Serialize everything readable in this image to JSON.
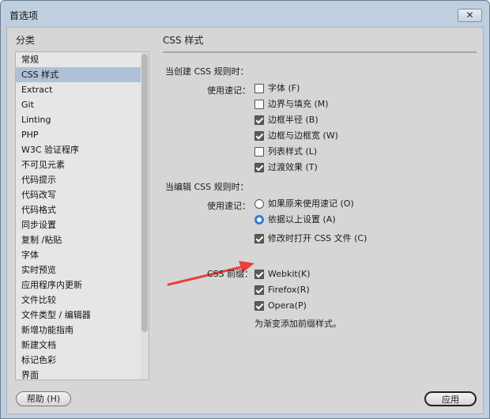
{
  "window": {
    "title": "首选项",
    "close_label": "✕"
  },
  "sidebar": {
    "heading": "分类",
    "items": [
      "常规",
      "CSS 样式",
      "Extract",
      "Git",
      "Linting",
      "PHP",
      "W3C 验证程序",
      "不可见元素",
      "代码提示",
      "代码改写",
      "代码格式",
      "同步设置",
      "复制 /粘贴",
      "字体",
      "实时预览",
      "应用程序内更新",
      "文件比较",
      "文件类型 / 编辑器",
      "新增功能指南",
      "新建文档",
      "标记色彩",
      "界面"
    ],
    "selected": "CSS 样式"
  },
  "panel": {
    "title": "CSS 样式",
    "create": {
      "heading": "当创建  CSS 规则时：",
      "shorthand_label": "使用速记：",
      "options": [
        {
          "label": "字体 (F)",
          "checked": false
        },
        {
          "label": "边界与填充 (M)",
          "checked": false
        },
        {
          "label": "边框半径 (B)",
          "checked": true
        },
        {
          "label": "边框与边框宽 (W)",
          "checked": true
        },
        {
          "label": "列表样式 (L)",
          "checked": false
        },
        {
          "label": "过渡效果 (T)",
          "checked": true
        }
      ]
    },
    "edit": {
      "heading": "当编辑  CSS 规则时：",
      "shorthand_label": "使用速记：",
      "radios": [
        {
          "label": "如果原来使用速记 (O)",
          "selected": false
        },
        {
          "label": "依据以上设置 (A)",
          "selected": true
        }
      ],
      "modify_open": {
        "label": "修改时打开  CSS 文件 (C)",
        "checked": true
      }
    },
    "prefix": {
      "label": "CSS 前缀：",
      "options": [
        {
          "label": "Webkit(K)",
          "checked": true
        },
        {
          "label": "Firefox(R)",
          "checked": true
        },
        {
          "label": "Opera(P)",
          "checked": true
        }
      ],
      "note": "为渐变添加前缀样式。"
    }
  },
  "buttons": {
    "help": "帮助 (H)",
    "apply": "应用"
  },
  "colors": {
    "window_frame": "#bfcfdf",
    "client_bg": "#d6d6d6",
    "selection": "#afc1d6",
    "radio_accent": "#2d7de6",
    "arrow": "#e8403c"
  }
}
